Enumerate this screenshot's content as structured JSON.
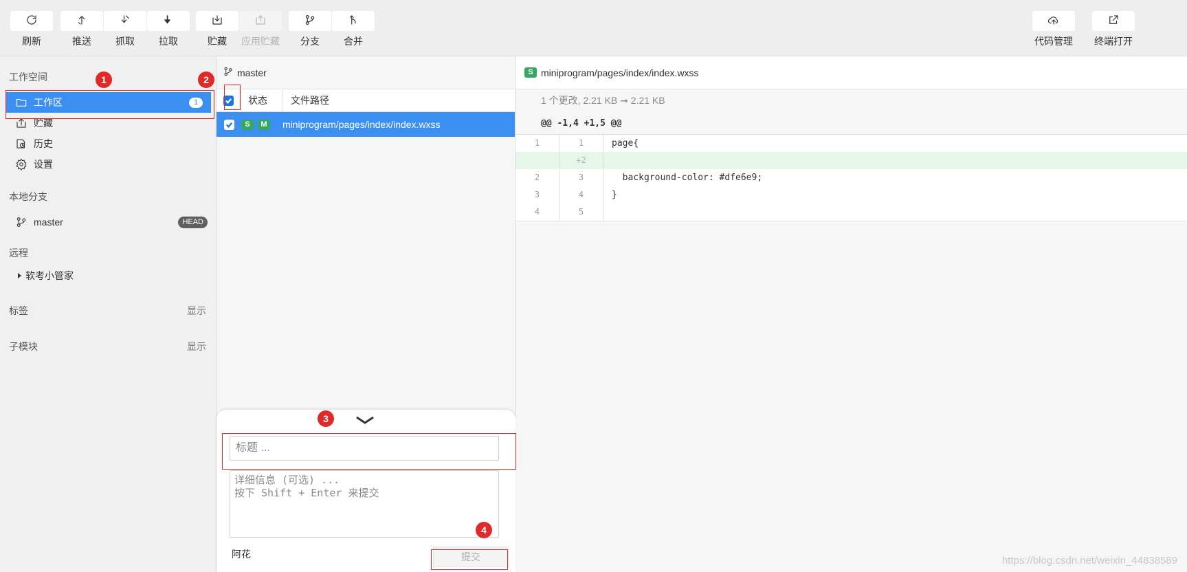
{
  "toolbar": {
    "left_buttons": [
      {
        "label": "刷新",
        "icon": "refresh-icon",
        "disabled": false
      },
      {
        "label": "推送",
        "icon": "push-icon",
        "disabled": false
      },
      {
        "label": "抓取",
        "icon": "fetch-icon",
        "disabled": false
      },
      {
        "label": "拉取",
        "icon": "pull-icon",
        "disabled": false
      },
      {
        "label": "贮藏",
        "icon": "stash-icon",
        "disabled": false
      },
      {
        "label": "应用贮藏",
        "icon": "apply-stash-icon",
        "disabled": true
      },
      {
        "label": "分支",
        "icon": "branch-icon",
        "disabled": false
      },
      {
        "label": "合并",
        "icon": "merge-icon",
        "disabled": false
      }
    ],
    "right_buttons": [
      {
        "label": "代码管理",
        "icon": "cloud-upload-icon"
      },
      {
        "label": "终端打开",
        "icon": "external-link-icon"
      }
    ]
  },
  "sidebar": {
    "workspace_title": "工作空间",
    "items": [
      {
        "label": "工作区",
        "icon": "folder-icon",
        "badge": "1",
        "active": true
      },
      {
        "label": "贮藏",
        "icon": "stash-icon"
      },
      {
        "label": "历史",
        "icon": "history-icon"
      },
      {
        "label": "设置",
        "icon": "gear-icon"
      }
    ],
    "local_branches_title": "本地分支",
    "local_branch": {
      "label": "master",
      "badge": "HEAD",
      "icon": "branch-icon"
    },
    "remote_title": "远程",
    "remote_item": "软考小管家",
    "tags_title": "标签",
    "tags_action": "显示",
    "submodules_title": "子模块",
    "submodules_action": "显示"
  },
  "changes": {
    "branch": "master",
    "col_status": "状态",
    "col_path": "文件路径",
    "files": [
      {
        "tag_s": "S",
        "tag_m": "M",
        "path": "miniprogram/pages/index/index.wxss",
        "checked": true
      }
    ]
  },
  "commit": {
    "title_placeholder": "标题 ...",
    "detail_placeholder": "详细信息 (可选) ...\n按下 Shift + Enter 来提交",
    "author": "阿花",
    "submit_label": "提交"
  },
  "diff": {
    "file_tag": "S",
    "file_path": "miniprogram/pages/index/index.wxss",
    "summary": "1 个更改, 2.21 KB ➞ 2.21 KB",
    "hunk": "@@ -1,4 +1,5 @@",
    "lines": [
      {
        "old": "1",
        "new": "1",
        "code": "page{",
        "type": "context"
      },
      {
        "old": "",
        "new": "+2",
        "code": "",
        "type": "added"
      },
      {
        "old": "2",
        "new": "3",
        "code": "  background-color: #dfe6e9;",
        "type": "context"
      },
      {
        "old": "3",
        "new": "4",
        "code": "}",
        "type": "context"
      },
      {
        "old": "4",
        "new": "5",
        "code": "",
        "type": "context"
      }
    ]
  },
  "annotations": [
    "1",
    "2",
    "3",
    "4"
  ],
  "watermark": "https://blog.csdn.net/weixin_44838589",
  "colors": {
    "accent": "#3b8ff0",
    "annotation": "#e02a2a",
    "added_bg": "#e6f7e9",
    "tag_green": "#37a862"
  }
}
